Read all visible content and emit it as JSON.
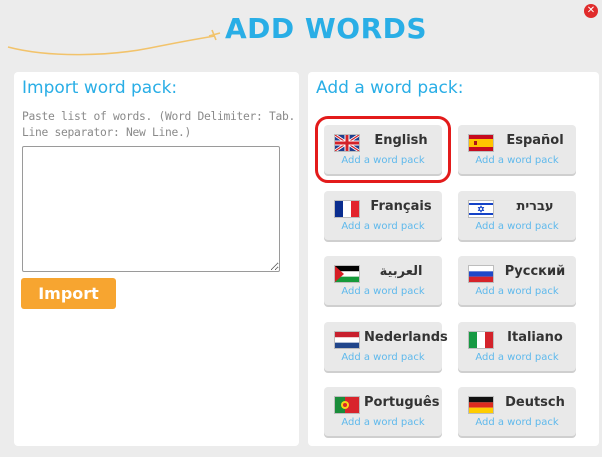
{
  "header": {
    "title": "ADD WORDS",
    "close_icon": "close-icon",
    "close_label": "✕"
  },
  "import_panel": {
    "heading": "Import word pack:",
    "hint": "Paste list of words. (Word Delimiter: Tab. Line separator: New Line.)",
    "textarea_value": "",
    "import_label": "Import"
  },
  "packs_panel": {
    "heading": "Add a word pack:",
    "packs": [
      {
        "name": "English",
        "sub": "Add a word pack",
        "flag": "uk-flag",
        "selected": true
      },
      {
        "name": "Español",
        "sub": "Add a word pack",
        "flag": "spain-flag"
      },
      {
        "name": "Français",
        "sub": "Add a word pack",
        "flag": "france-flag"
      },
      {
        "name": "עברית",
        "sub": "Add a word pack",
        "flag": "israel-flag"
      },
      {
        "name": "العربية",
        "sub": "Add a word pack",
        "flag": "arabic-flag"
      },
      {
        "name": "Русский",
        "sub": "Add a word pack",
        "flag": "russia-flag"
      },
      {
        "name": "Nederlands",
        "sub": "Add a word pack",
        "flag": "netherlands-flag"
      },
      {
        "name": "Italiano",
        "sub": "Add a word pack",
        "flag": "italy-flag"
      },
      {
        "name": "Português",
        "sub": "Add a word pack",
        "flag": "portugal-flag"
      },
      {
        "name": "Deutsch",
        "sub": "Add a word pack",
        "flag": "germany-flag"
      }
    ]
  },
  "colors": {
    "accent": "#29aee6",
    "import_button": "#f7a530",
    "highlight": "#e31b1b"
  }
}
